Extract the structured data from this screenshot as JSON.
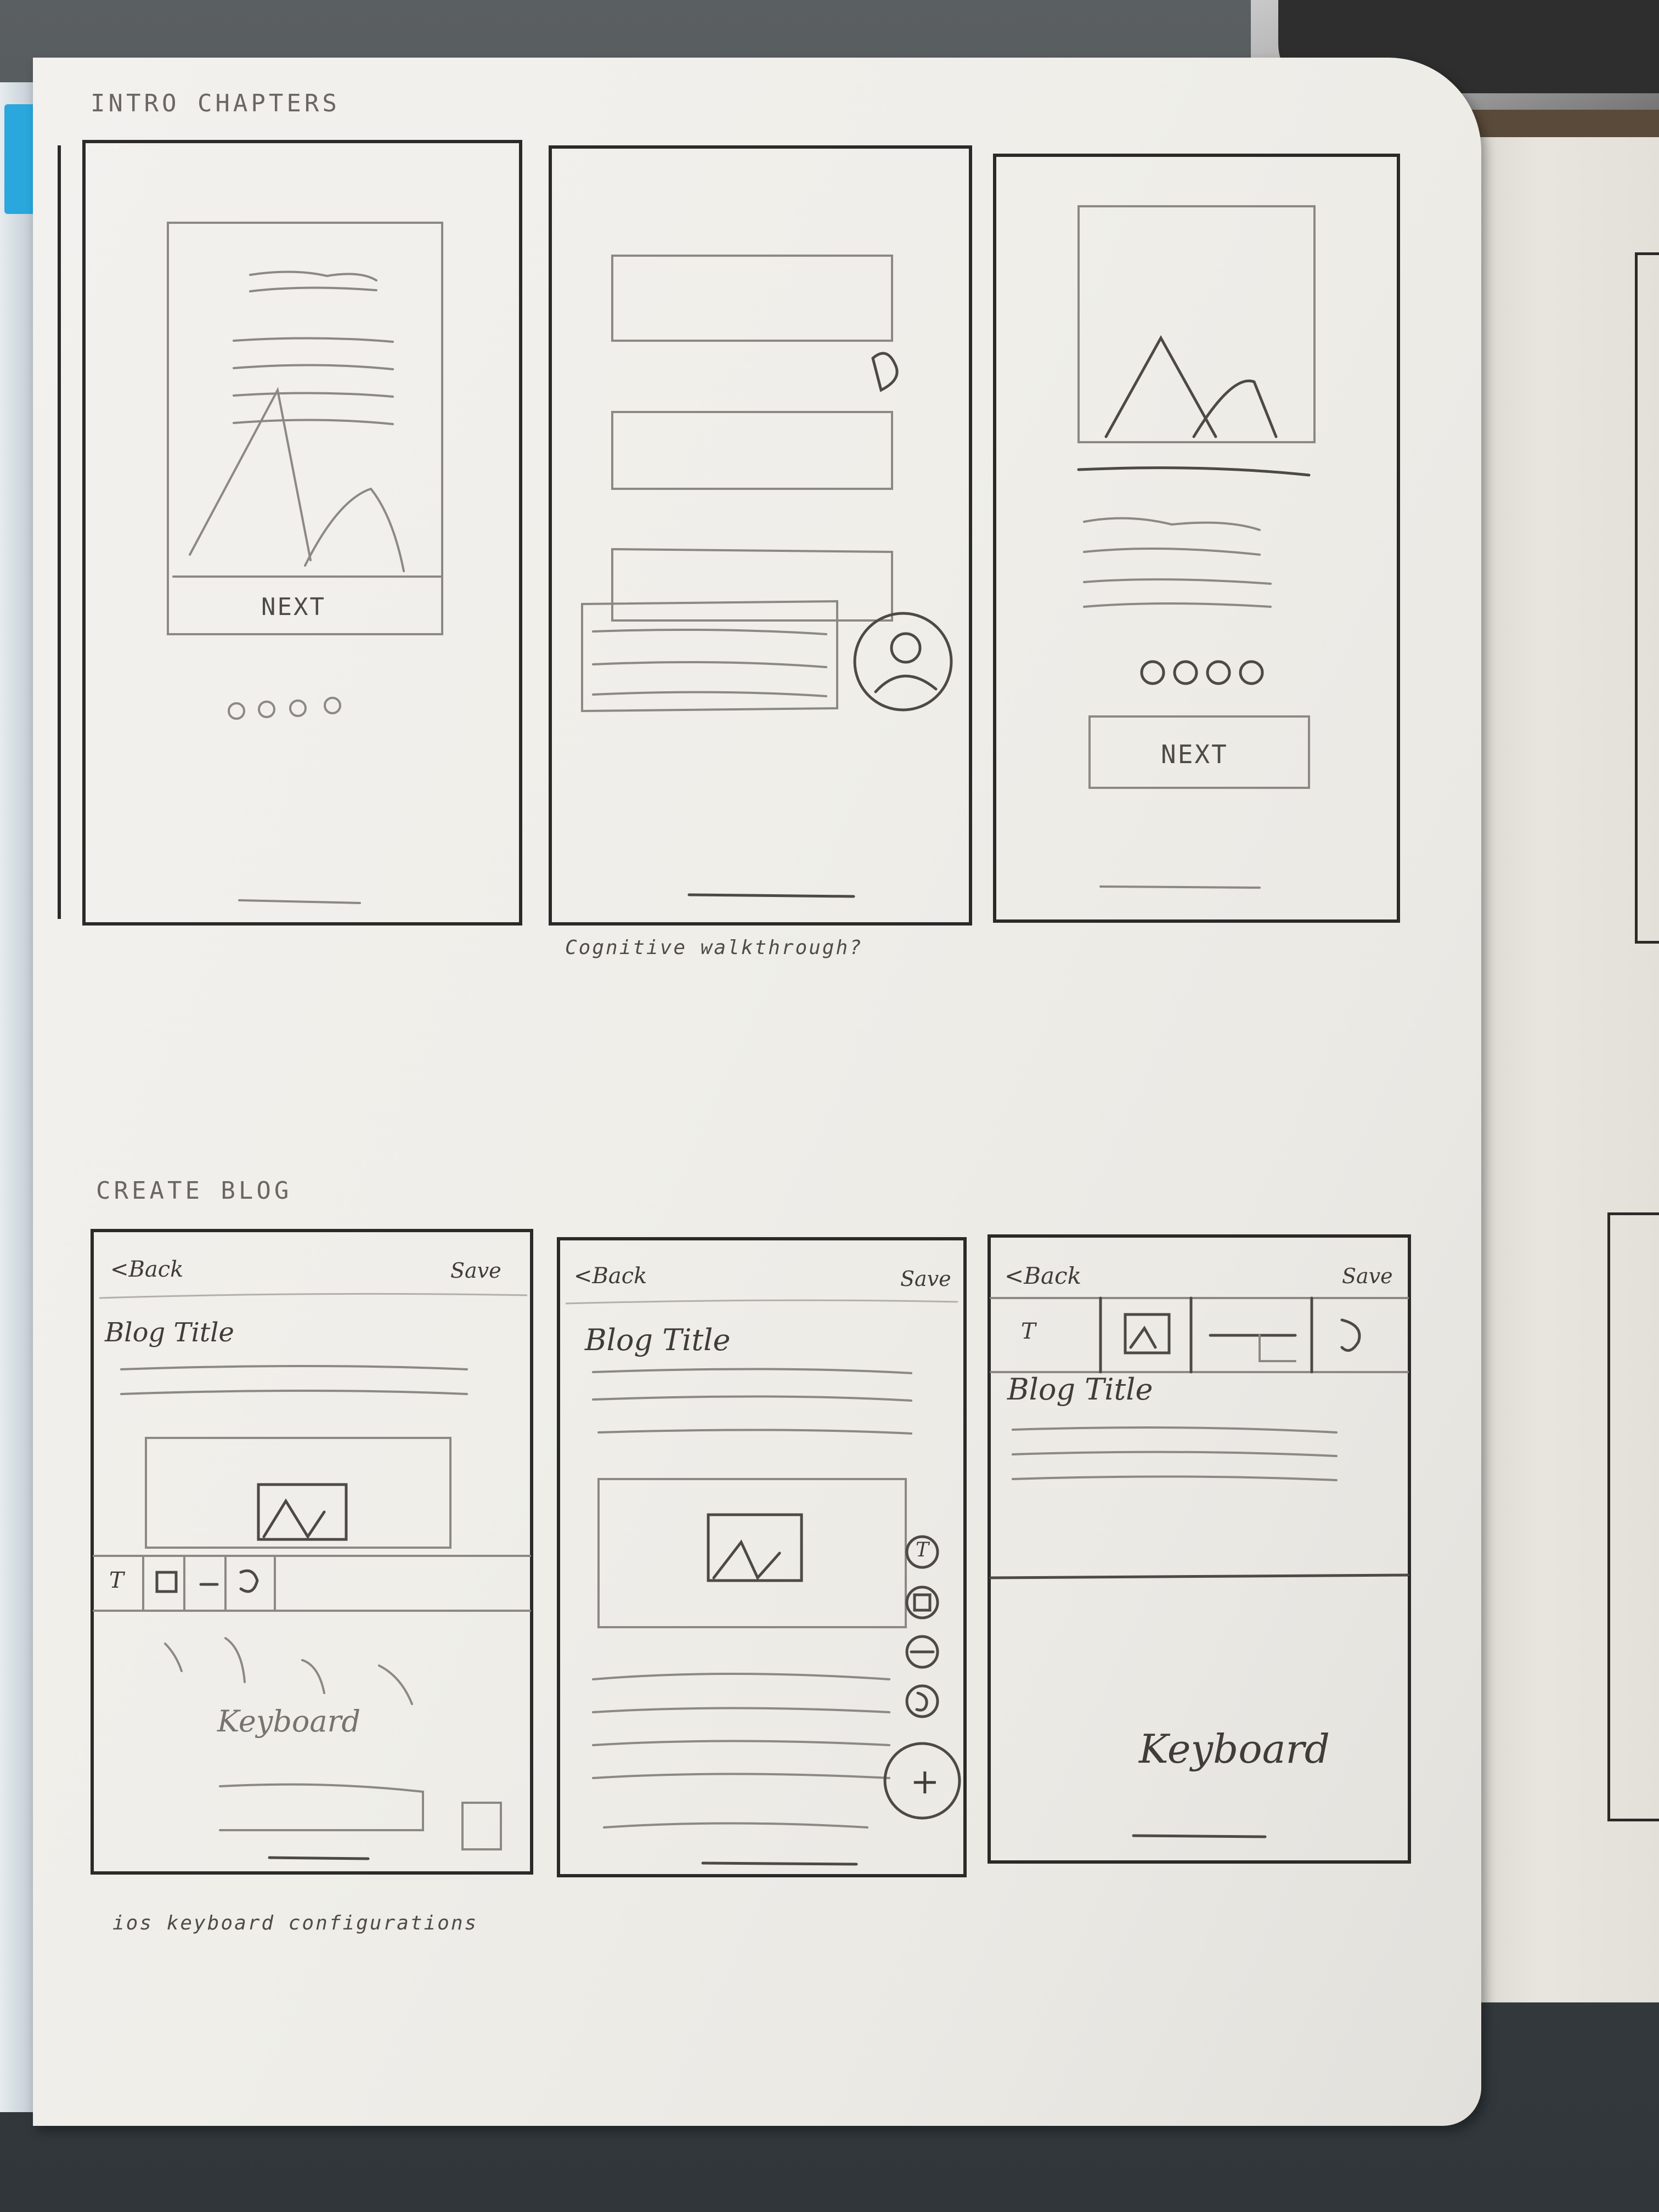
{
  "sections": {
    "intro": {
      "label": "INTRO CHAPTERS"
    },
    "create": {
      "label": "CREATE BLOG"
    }
  },
  "intro_screens": {
    "screen1": {
      "button": "NEXT"
    },
    "screen3": {
      "button": "NEXT"
    }
  },
  "notes": {
    "walkthrough": "Cognitive walkthrough?",
    "ios": "ios keyboard configurations"
  },
  "blog_screens": {
    "screen1": {
      "back": "<Back",
      "save": "Save",
      "title": "Blog Title",
      "toolbar_text_icon": "T",
      "keyboard": "Keyboard"
    },
    "screen2": {
      "back": "<Back",
      "save": "Save",
      "title": "Blog Title",
      "fab_text_icon": "T",
      "fab_plus": "+"
    },
    "screen3": {
      "back": "<Back",
      "save": "Save",
      "title": "Blog Title",
      "toolbar_text_icon": "T",
      "keyboard": "Keyboard"
    }
  },
  "icons": [
    "text-icon",
    "image-icon",
    "divider-icon",
    "link-icon",
    "plus-icon",
    "avatar-icon",
    "pointer-hand-icon",
    "mountain-image-icon"
  ],
  "colors": {
    "paper": "#efeee9",
    "pencil": "#5e5b57",
    "ink": "#2b2a28",
    "tab": "#2aa7dc"
  }
}
